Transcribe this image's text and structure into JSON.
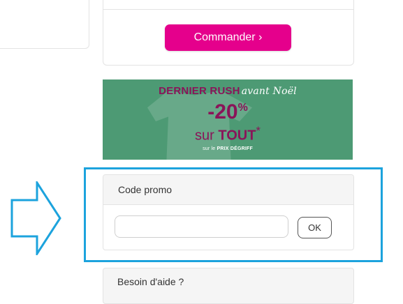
{
  "order": {
    "button_label": "Commander ›"
  },
  "banner": {
    "line1_bold": "DERNIER RUSH",
    "line1_script": "avant Noël",
    "discount": "-20",
    "percent": "%",
    "line3_prefix": "sur ",
    "line3_bold": "TOUT",
    "line3_suffix": "*",
    "footnote_prefix": "sur le ",
    "footnote_bold": "PRIX DÉGRIFF"
  },
  "promo": {
    "title": "Code promo",
    "input_value": "",
    "input_placeholder": "",
    "ok_label": "OK"
  },
  "help": {
    "title": "Besoin d'aide ?"
  },
  "colors": {
    "order_button": "#e5008c",
    "banner_bg": "#4d9a74",
    "banner_text": "#8a1459",
    "highlight_border": "#1ca3dd"
  },
  "icons": {
    "pointer_arrow": "right-arrow-outline-icon"
  }
}
